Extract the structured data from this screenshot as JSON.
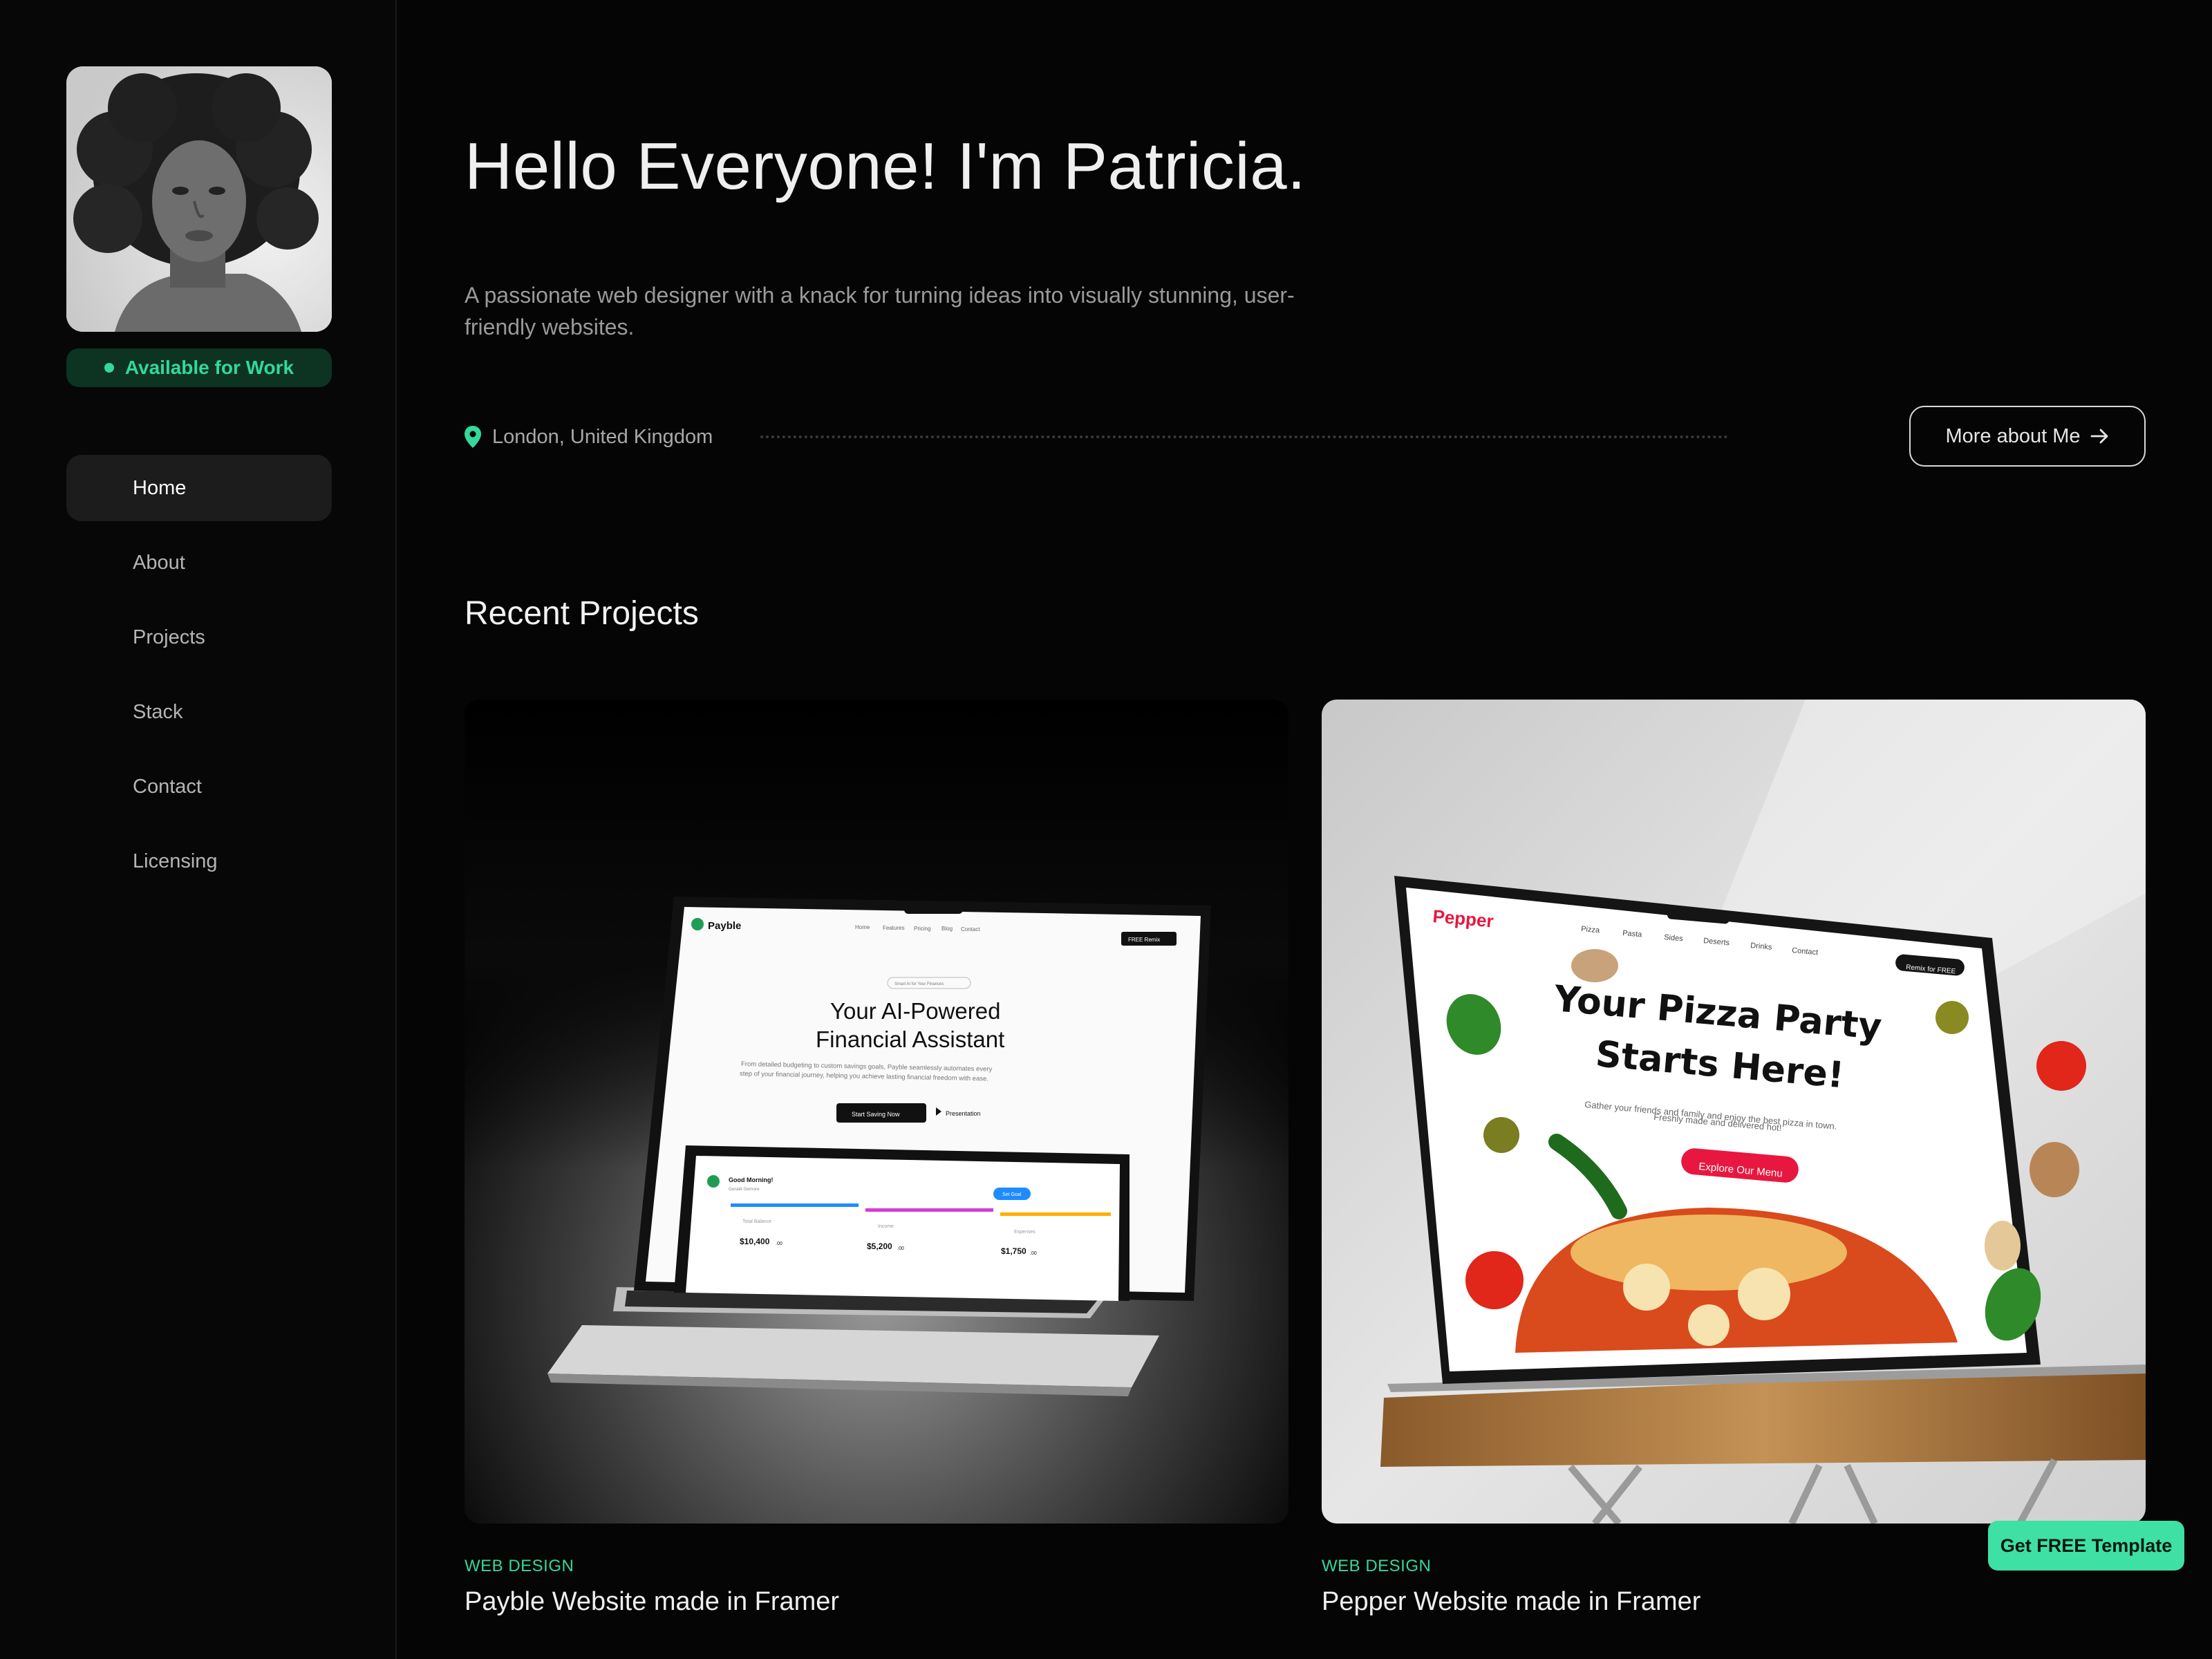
{
  "profile": {
    "status_badge": "Available for Work",
    "status_color": "#34d89a"
  },
  "nav": {
    "items": [
      {
        "label": "Home",
        "active": true
      },
      {
        "label": "About",
        "active": false
      },
      {
        "label": "Projects",
        "active": false
      },
      {
        "label": "Stack",
        "active": false
      },
      {
        "label": "Contact",
        "active": false
      },
      {
        "label": "Licensing",
        "active": false
      }
    ]
  },
  "hero": {
    "title": "Hello Everyone! I'm Patricia.",
    "description": "A passionate web designer with a knack for turning ideas into visually stunning, user-friendly websites.",
    "location": "London, United Kingdom",
    "location_icon": "map-pin-icon",
    "cta_label": "More about Me",
    "cta_icon": "arrow-right-icon"
  },
  "projects": {
    "section_title": "Recent Projects",
    "cards": [
      {
        "category": "WEB DESIGN",
        "title": "Payble Website made in Framer",
        "mockup": {
          "brand": "Payble",
          "nav": [
            "Home",
            "Features",
            "Pricing",
            "Blog",
            "Contact"
          ],
          "nav_button": "FREE Remix",
          "pill": "Smart AI for Your Finances",
          "headline_line1": "Your AI-Powered",
          "headline_line2": "Financial Assistant",
          "subtext_line1": "From detailed budgeting to custom savings goals, Payble seamlessly automates every",
          "subtext_line2": "step of your financial journey, helping you achieve lasting financial freedom with ease.",
          "primary_button": "Start Saving Now",
          "secondary_button": "Presentation",
          "dash_greeting": "Good Morning!",
          "dash_sub": "Gerald Gemore",
          "dash_btn": "Set Goal",
          "stat1_label": "Total Balance",
          "stat1_value": "$10,400",
          "stat2_label": "Income",
          "stat2_value": "$5,200",
          "stat3_label": "Expenses",
          "stat3_value": "$1,750",
          "stat_cents": ".00"
        }
      },
      {
        "category": "WEB DESIGN",
        "title": "Pepper Website made in Framer",
        "mockup": {
          "brand": "Pepper",
          "nav": [
            "Pizza",
            "Pasta",
            "Sides",
            "Deserts",
            "Drinks",
            "Contact"
          ],
          "nav_button": "Remix for FREE",
          "headline_line1": "Your Pizza Party",
          "headline_line2": "Starts Here!",
          "subtext_line1": "Gather your friends and family and enjoy the best pizza in town.",
          "subtext_line2": "Freshly made and delivered hot!",
          "cta": "Explore Our Menu",
          "brand_color": "#e8173f"
        }
      }
    ]
  },
  "floating_cta": {
    "label": "Get FREE Template",
    "color": "#3ee0a4"
  }
}
